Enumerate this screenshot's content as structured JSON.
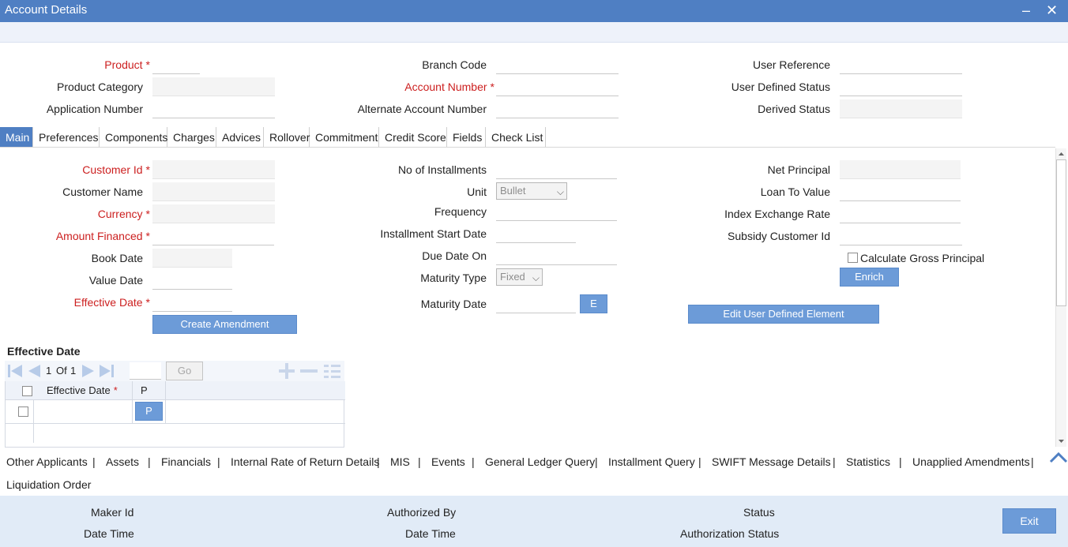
{
  "window": {
    "title": "Account Details",
    "minimize": "–",
    "close": "✕"
  },
  "header_fields": {
    "product": {
      "label": "Product",
      "value": ""
    },
    "product_category": {
      "label": "Product Category",
      "value": ""
    },
    "application_number": {
      "label": "Application Number",
      "value": ""
    },
    "branch_code": {
      "label": "Branch Code",
      "value": ""
    },
    "account_number": {
      "label": "Account Number",
      "value": ""
    },
    "alternate_account_number": {
      "label": "Alternate Account Number",
      "value": ""
    },
    "user_reference": {
      "label": "User Reference",
      "value": ""
    },
    "user_defined_status": {
      "label": "User Defined Status",
      "value": ""
    },
    "derived_status": {
      "label": "Derived Status",
      "value": ""
    }
  },
  "required_marker": "*",
  "tabs": [
    "Main",
    "Preferences",
    "Components",
    "Charges",
    "Advices",
    "Rollover",
    "Commitment",
    "Credit Score",
    "Fields",
    "Check List"
  ],
  "main": {
    "customer_id": {
      "label": "Customer Id",
      "value": ""
    },
    "customer_name": {
      "label": "Customer Name",
      "value": ""
    },
    "currency": {
      "label": "Currency",
      "value": ""
    },
    "amount_financed": {
      "label": "Amount Financed",
      "value": ""
    },
    "book_date": {
      "label": "Book Date",
      "value": ""
    },
    "value_date": {
      "label": "Value Date",
      "value": ""
    },
    "effective_date": {
      "label": "Effective Date",
      "value": ""
    },
    "create_amendment": "Create Amendment",
    "no_of_installments": {
      "label": "No of Installments",
      "value": ""
    },
    "unit": {
      "label": "Unit",
      "value": "Bullet"
    },
    "frequency": {
      "label": "Frequency",
      "value": ""
    },
    "installment_start_date": {
      "label": "Installment Start Date",
      "value": ""
    },
    "due_date_on": {
      "label": "Due Date On",
      "value": ""
    },
    "maturity_type": {
      "label": "Maturity Type",
      "value": "Fixed"
    },
    "maturity_date": {
      "label": "Maturity Date",
      "value": ""
    },
    "e_button": "E",
    "net_principal": {
      "label": "Net Principal",
      "value": ""
    },
    "loan_to_value": {
      "label": "Loan To Value",
      "value": ""
    },
    "index_exchange_rate": {
      "label": "Index Exchange Rate",
      "value": ""
    },
    "subsidy_customer_id": {
      "label": "Subsidy Customer Id",
      "value": ""
    },
    "calculate_gross_principal": "Calculate Gross Principal",
    "enrich": "Enrich",
    "edit_user_defined_element": "Edit User Defined Element"
  },
  "effective_date_grid": {
    "title": "Effective Date",
    "page_current": "1",
    "page_of": "Of",
    "page_total": "1",
    "go": "Go",
    "col_effective_date": "Effective Date",
    "col_p": "P",
    "row_p_button": "P"
  },
  "footer_links": [
    "Other Applicants",
    "Assets",
    "Financials",
    "Internal Rate of Return Details",
    "MIS",
    "Events",
    "General Ledger Query",
    "Installment Query",
    "SWIFT Message Details",
    "Statistics",
    "Unapplied Amendments",
    "Liquidation Order"
  ],
  "link_separator": "|",
  "audit": {
    "maker_id": "Maker Id",
    "date_time_1": "Date Time",
    "authorized_by": "Authorized By",
    "date_time_2": "Date Time",
    "status": "Status",
    "authorization_status": "Authorization Status",
    "exit": "Exit"
  },
  "colors": {
    "titlebar": "#4f7fc3",
    "required": "#cc1f1f",
    "button": "#6c9bd8",
    "audit_bg": "#e1ebf7"
  }
}
